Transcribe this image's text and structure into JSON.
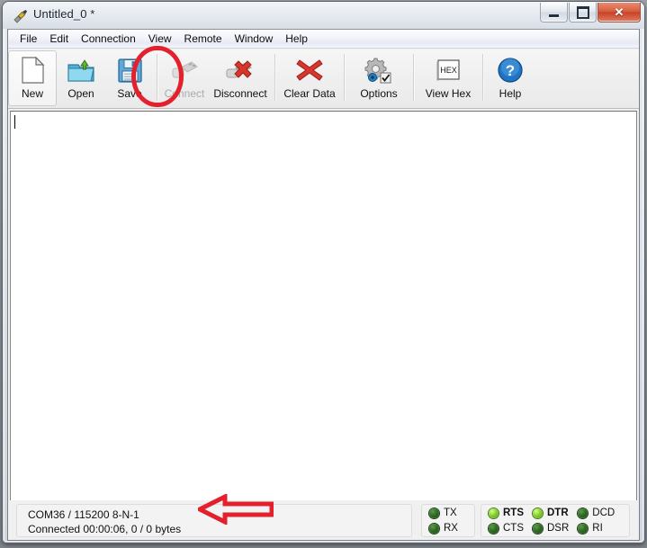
{
  "window": {
    "title": "Untitled_0 *",
    "app_icon": "plug-icon",
    "controls": {
      "minimize": "minimize-icon",
      "maximize": "maximize-icon",
      "close": "✕"
    }
  },
  "menubar": {
    "items": [
      {
        "label": "File"
      },
      {
        "label": "Edit"
      },
      {
        "label": "Connection"
      },
      {
        "label": "View"
      },
      {
        "label": "Remote"
      },
      {
        "label": "Window"
      },
      {
        "label": "Help"
      }
    ]
  },
  "toolbar": {
    "buttons": [
      {
        "label": "New",
        "icon": "new-document-icon",
        "disabled": false,
        "hovered": true
      },
      {
        "label": "Open",
        "icon": "open-folder-icon",
        "disabled": false,
        "hovered": false
      },
      {
        "label": "Save",
        "icon": "save-floppy-icon",
        "disabled": false,
        "hovered": false
      },
      {
        "label": "Connect",
        "icon": "usb-plug-icon",
        "disabled": true,
        "hovered": false
      },
      {
        "label": "Disconnect",
        "icon": "usb-plug-disconnect-icon",
        "disabled": false,
        "hovered": false
      },
      {
        "label": "Clear Data",
        "icon": "red-x-icon",
        "disabled": false,
        "hovered": false
      },
      {
        "label": "Options",
        "icon": "gears-icon",
        "disabled": false,
        "hovered": false
      },
      {
        "label": "View Hex",
        "icon": "hex-box-icon",
        "disabled": false,
        "hovered": false
      },
      {
        "label": "Help",
        "icon": "blue-question-icon",
        "disabled": false,
        "hovered": false
      }
    ]
  },
  "terminal": {
    "content": ""
  },
  "statusbar": {
    "line1": "COM36 / 115200 8-N-1",
    "line2": "Connected 00:00:06, 0 / 0 bytes",
    "led_groups": [
      {
        "columns": [
          {
            "leds": [
              {
                "label": "TX",
                "state": "off",
                "bold": false
              },
              {
                "label": "RX",
                "state": "off",
                "bold": false
              }
            ]
          }
        ]
      },
      {
        "columns": [
          {
            "leds": [
              {
                "label": "RTS",
                "state": "on",
                "bold": true
              },
              {
                "label": "CTS",
                "state": "off",
                "bold": false
              }
            ]
          },
          {
            "leds": [
              {
                "label": "DTR",
                "state": "on",
                "bold": true
              },
              {
                "label": "DSR",
                "state": "off",
                "bold": false
              }
            ]
          },
          {
            "leds": [
              {
                "label": "DCD",
                "state": "off",
                "bold": false
              },
              {
                "label": "RI",
                "state": "off",
                "bold": false
              }
            ]
          }
        ]
      }
    ]
  },
  "annotations": {
    "color": "#e3202c",
    "ellipse_target": "Connect",
    "arrow_direction": "left",
    "arrow_target": "status-bar-connection-info"
  }
}
